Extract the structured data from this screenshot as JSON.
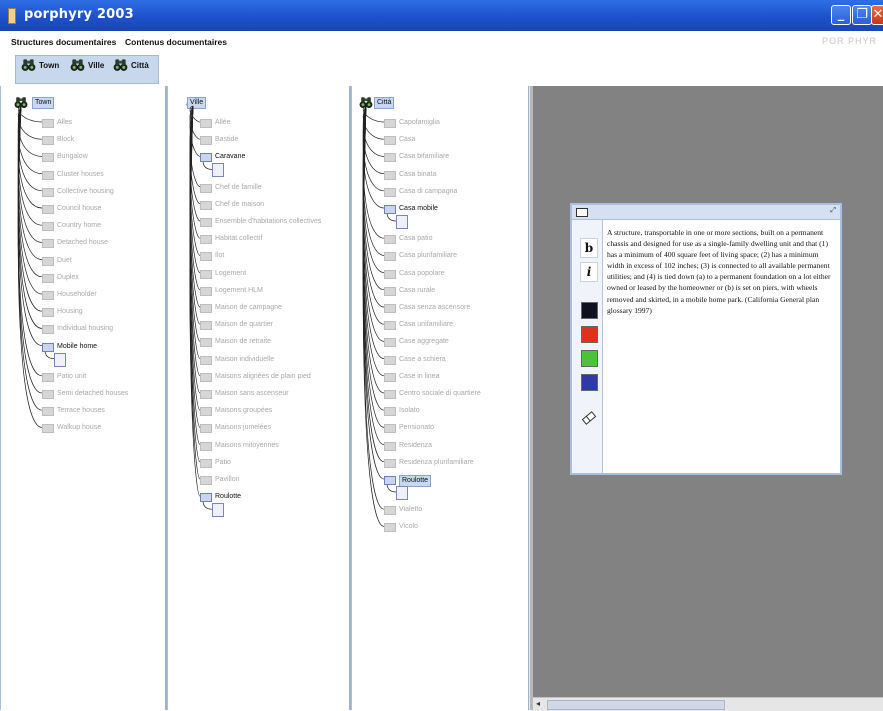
{
  "window": {
    "title": "porphyry 2003",
    "buttons": [
      "minimize",
      "maximize",
      "close"
    ]
  },
  "menu": {
    "items": [
      "Structures documentaires",
      "Contenus documentaires"
    ],
    "right_text": "POR PHYR"
  },
  "toolbar": {
    "buttons": [
      "Town",
      "Ville",
      "Città"
    ]
  },
  "panels": [
    {
      "root": "Town",
      "nodes": [
        "Alles",
        "Block",
        "Bungalow",
        "Cluster houses",
        "Collective housing",
        "Council house",
        "Country home",
        "Detached house",
        "Duet",
        "Duplex",
        "Householder",
        "Housing",
        "Individual housing",
        "Mobile home",
        "Patio unit",
        "Semi detached houses",
        "Terrace houses",
        "Walkup house"
      ],
      "active": [
        "Mobile home"
      ]
    },
    {
      "root": "Ville",
      "nodes": [
        "Allée",
        "Bastide",
        "Caravane",
        "Chef de famille",
        "Chef de maison",
        "Ensemble d'habitations collectives",
        "Habitat collectif",
        "Ilot",
        "Logement",
        "Logement HLM",
        "Maison de campagne",
        "Maison de quartier",
        "Maison de retraite",
        "Maison individuelle",
        "Maisons alignées de plain pied",
        "Maison sans ascenseur",
        "Maisons groupées",
        "Maisons jumelées",
        "Maisons mitoyennes",
        "Patio",
        "Pavillon",
        "Roulotte"
      ],
      "active": [
        "Caravane",
        "Roulotte"
      ]
    },
    {
      "root": "Città",
      "nodes": [
        "Capofamiglia",
        "Casa",
        "Casa bifamiliare",
        "Casa binata",
        "Casa di campagna",
        "Casa mobile",
        "Casa patio",
        "Casa plurifamiliare",
        "Casa popolare",
        "Casa rurale",
        "Casa senza ascensore",
        "Casa unifamiliare",
        "Case aggregate",
        "Case a schiera",
        "Case in linea",
        "Centro sociale di quartiere",
        "Isolato",
        "Pensionato",
        "Residenza",
        "Residenza plurifamiliare",
        "Roulotte",
        "Vialetto",
        "Vicolo"
      ],
      "active": [
        "Casa mobile",
        "Roulotte"
      ]
    }
  ],
  "note": {
    "format_buttons": [
      "b",
      "i"
    ],
    "swatches": [
      "#0d1120",
      "#e0301e",
      "#4cc23a",
      "#2b3aa8"
    ],
    "tool_icon": "eraser-icon",
    "text": "A structure, transportable in one or more sections, built on a permanent chassis and designed for use as a single-family dwelling unit and that (1) has a minimum of 400 square feet of living space; (2) has a minimum width in excess of 102 inches; (3) is connected to all available permanent utilities; and (4) is tied down (a) to a permanent foundation on a lot either owned or leased by the homeowner or (b) is set on piers, with wheels removed and skirted, in a mobile home park. (California General plan glossary 1997)"
  }
}
